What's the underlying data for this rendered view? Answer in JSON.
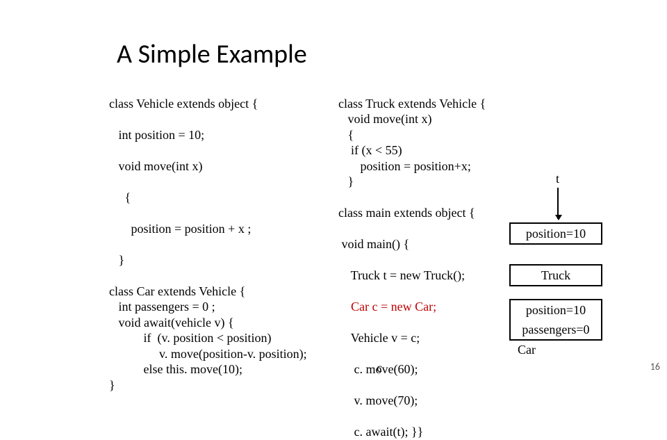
{
  "title": "A Simple Example",
  "col_left": {
    "l1": "class Vehicle extends object {",
    "l2": "   int position = 10;",
    "l3": "   void move(int x)",
    "l4": "     {",
    "l5": "       position = position + x ;",
    "l6": "   }",
    "l7": "class Car extends Vehicle {",
    "l8": "   int passengers = 0 ;",
    "l9": "   void await(vehicle v) {",
    "l10": "           if  (v. position < position)",
    "l11": "                v. move(position-v. position);",
    "l12": "           else this. move(10);",
    "l13": "}"
  },
  "col_mid": {
    "l1": "class Truck extends Vehicle {",
    "l2": "   void move(int x)",
    "l3": "   {",
    "l4": "    if (x < 55) ",
    "l5": "       position = position+x;",
    "l6": "   }",
    "l7": "class main extends object {",
    "l8": " void main() {",
    "l9": "    Truck t = new Truck();",
    "l10": "    Car c = new Car;",
    "l11": "    Vehicle v = c;",
    "l12": "     c. move(60);",
    "l13": "     v. move(70);",
    "l14": "     c. await(t); }}"
  },
  "labels": {
    "t": "t",
    "car": "Car",
    "c": "c"
  },
  "boxes": {
    "pos10a": "position=10",
    "truck": "Truck",
    "pos10b": "position=10",
    "passengers": "passengers=0"
  },
  "page": "16"
}
